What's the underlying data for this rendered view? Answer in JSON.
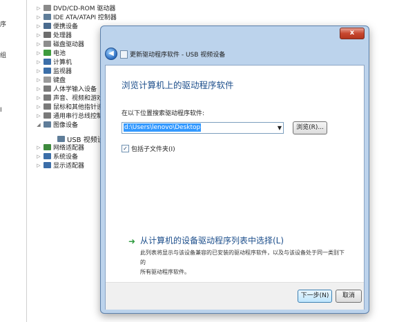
{
  "left_panel": {
    "fragments": [
      "序",
      "组",
      "I"
    ]
  },
  "device_tree": [
    {
      "label": "DVD/CD-ROM 驱动器",
      "icon": "dvd-drive-icon",
      "color": "#8a8a8a"
    },
    {
      "label": "IDE ATA/ATAPI 控制器",
      "icon": "ide-controller-icon",
      "color": "#5f7d99"
    },
    {
      "label": "便携设备",
      "icon": "portable-device-icon",
      "color": "#4a6b8e"
    },
    {
      "label": "处理器",
      "icon": "processor-icon",
      "color": "#6e6e6e"
    },
    {
      "label": "磁盘驱动器",
      "icon": "disk-drive-icon",
      "color": "#8d8d8d"
    },
    {
      "label": "电池",
      "icon": "battery-icon",
      "color": "#3d9b3d"
    },
    {
      "label": "计算机",
      "icon": "computer-icon",
      "color": "#3b6ea8"
    },
    {
      "label": "监视器",
      "icon": "monitor-icon",
      "color": "#3b6ea8"
    },
    {
      "label": "键盘",
      "icon": "keyboard-icon",
      "color": "#9a9a9a"
    },
    {
      "label": "人体学输入设备",
      "icon": "hid-icon",
      "color": "#7a7a7a"
    },
    {
      "label": "声音、视频和游戏控",
      "icon": "sound-icon",
      "color": "#7a7a7a"
    },
    {
      "label": "鼠标和其他指针设备",
      "icon": "mouse-icon",
      "color": "#7a7a7a"
    },
    {
      "label": "通用串行总线控制器",
      "icon": "usb-icon",
      "color": "#7a7a7a"
    },
    {
      "label": "图像设备",
      "icon": "imaging-device-icon",
      "color": "#5f7d99"
    },
    {
      "label": "USB 视频设备",
      "icon": "usb-video-device-icon",
      "color": "#5f7d99"
    },
    {
      "label": "网络适配器",
      "icon": "network-adapter-icon",
      "color": "#3d8a3d"
    },
    {
      "label": "系统设备",
      "icon": "system-device-icon",
      "color": "#3b6ea8"
    },
    {
      "label": "显示适配器",
      "icon": "display-adapter-icon",
      "color": "#3b6ea8"
    }
  ],
  "dialog": {
    "title": "更新驱动程序软件 - USB 视频设备",
    "heading": "浏览计算机上的驱动程序软件",
    "search_label": "在以下位置搜索驱动程序软件:",
    "path_value": "d:\\Users\\lenovo\\Desktop",
    "browse_label": "浏览(R)...",
    "include_subfolders_label": "包括子文件夹(I)",
    "include_subfolders_checked": true,
    "pick_title": "从计算机的设备驱动程序列表中选择(L)",
    "pick_desc_line1": "此列表将显示与该设备兼容的已安装的驱动程序软件，以及与该设备处于同一类别下的",
    "pick_desc_line2": "所有驱动程序软件。",
    "next_label": "下一步(N)",
    "cancel_label": "取消",
    "close_label": "x"
  },
  "colors": {
    "heading": "#1c4e8b",
    "selection": "#3399ff",
    "close_button": "#c7472f",
    "dialog_frame": "#bcd3ec"
  }
}
